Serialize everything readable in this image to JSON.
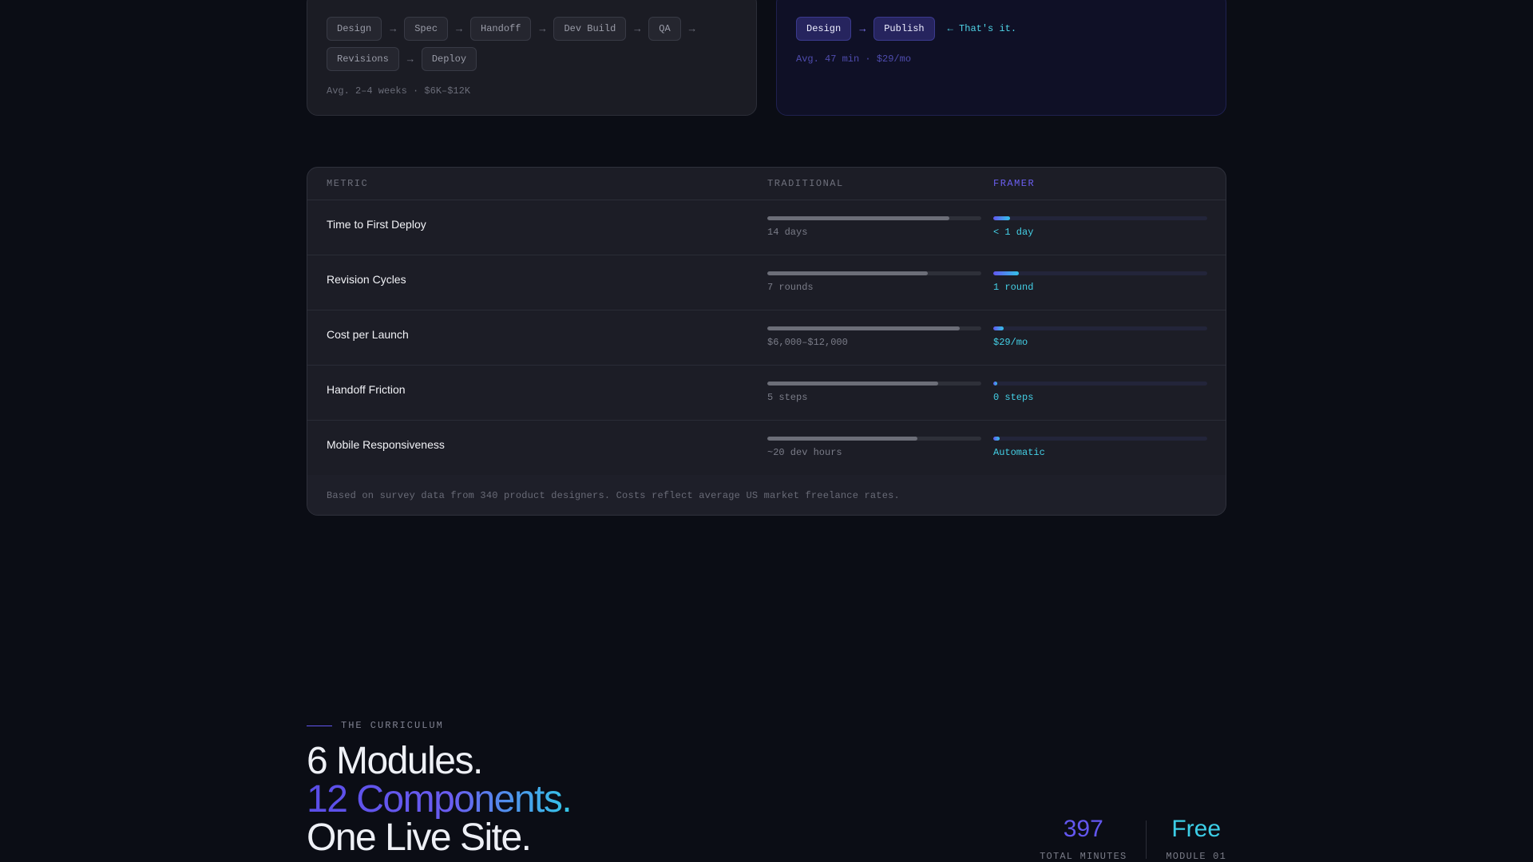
{
  "traditional_card": {
    "steps": [
      "Design",
      "Spec",
      "Handoff",
      "Dev Build",
      "QA",
      "Revisions",
      "Deploy"
    ],
    "avg": "Avg. 2–4 weeks · $6K–$12K"
  },
  "framer_card": {
    "steps": [
      "Design",
      "Publish"
    ],
    "note": "← That's it.",
    "avg": "Avg. 47 min · $29/mo"
  },
  "table": {
    "headers": {
      "metric": "METRIC",
      "traditional": "TRADITIONAL",
      "framer": "FRAMER"
    },
    "rows": [
      {
        "metric": "Time to First Deploy",
        "traditional": "14 days",
        "traditional_pct": 85,
        "framer": "< 1 day",
        "framer_pct": 8
      },
      {
        "metric": "Revision Cycles",
        "traditional": "7 rounds",
        "traditional_pct": 75,
        "framer": "1 round",
        "framer_pct": 12
      },
      {
        "metric": "Cost per Launch",
        "traditional": "$6,000–$12,000",
        "traditional_pct": 90,
        "framer": "$29/mo",
        "framer_pct": 5
      },
      {
        "metric": "Handoff Friction",
        "traditional": "5 steps",
        "traditional_pct": 80,
        "framer": "0 steps",
        "framer_pct": 2
      },
      {
        "metric": "Mobile Responsiveness",
        "traditional": "~20 dev hours",
        "traditional_pct": 70,
        "framer": "Automatic",
        "framer_pct": 3
      }
    ],
    "footnote": "Based on survey data from 340 product designers. Costs reflect average US market freelance rates."
  },
  "curriculum": {
    "eyebrow": "THE CURRICULUM",
    "headline": [
      "6 Modules.",
      "12 Components.",
      "One Live Site."
    ],
    "stats": [
      {
        "value": "397",
        "label": "TOTAL MINUTES"
      },
      {
        "value": "Free",
        "label": "MODULE 01"
      }
    ]
  },
  "colors": {
    "background": "#0b0d15",
    "accent_purple": "#6357f0",
    "accent_cyan": "#3ccde6"
  }
}
